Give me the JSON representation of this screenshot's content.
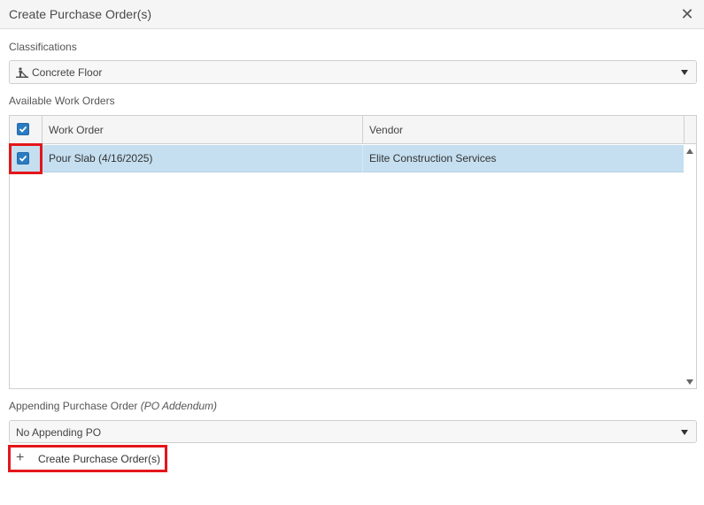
{
  "dialog": {
    "title": "Create Purchase Order(s)",
    "close_glyph": "✕"
  },
  "classifications": {
    "label": "Classifications",
    "selected": "Concrete Floor",
    "icon": "worker-icon"
  },
  "work_orders": {
    "label": "Available Work Orders",
    "columns": [
      "Work Order",
      "Vendor"
    ],
    "header_checked": true,
    "rows": [
      {
        "checked": true,
        "work_order": "Pour Slab (4/16/2025)",
        "vendor": "Elite Construction Services"
      }
    ]
  },
  "appending": {
    "label": "Appending Purchase Order ",
    "label_hint": "(PO Addendum)",
    "selected": "No Appending PO"
  },
  "actions": {
    "create_label": "Create Purchase Order(s)",
    "create_icon": "plus-icon"
  },
  "colors": {
    "selected_row": "#c5dff0",
    "checkbox": "#2b7bc0",
    "highlight": "#e3161b"
  }
}
